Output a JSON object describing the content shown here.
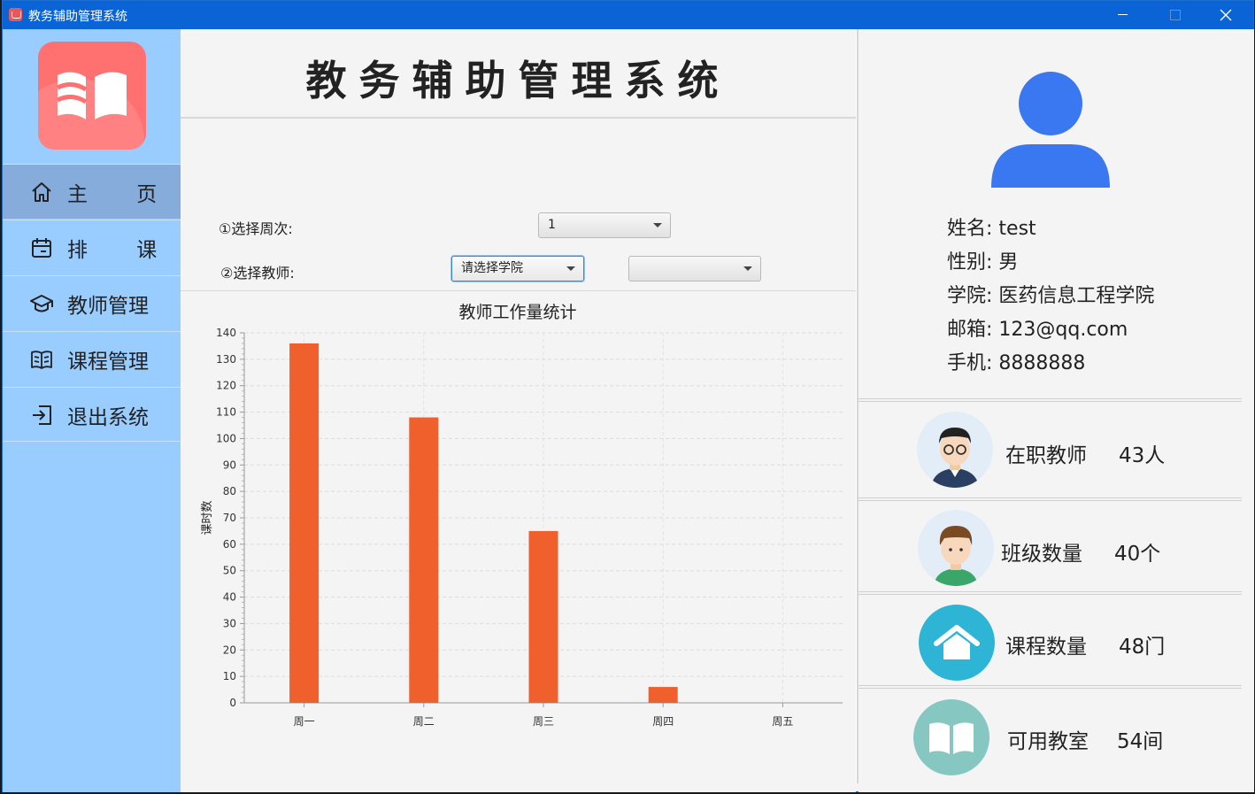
{
  "window": {
    "title": "教务辅助管理系统"
  },
  "sidebar": {
    "items": [
      {
        "label": "主 页",
        "icon": "home-icon",
        "active": true
      },
      {
        "label": "排 课",
        "icon": "calendar-icon",
        "active": false
      },
      {
        "label": "教师管理",
        "icon": "graduation-cap-icon",
        "active": false
      },
      {
        "label": "课程管理",
        "icon": "book-open-icon",
        "active": false
      },
      {
        "label": "退出系统",
        "icon": "logout-icon",
        "active": false
      }
    ]
  },
  "main": {
    "title": "教务辅助管理系统",
    "week_label": "①选择周次:",
    "week_value": "1",
    "teacher_label": "②选择教师:",
    "college_placeholder": "请选择学院",
    "teacher_value": ""
  },
  "chart_data": {
    "type": "bar",
    "title": "教师工作量统计",
    "ylabel": "课时数",
    "xlabel": "",
    "categories": [
      "周一",
      "周二",
      "周三",
      "周四",
      "周五"
    ],
    "values": [
      136,
      108,
      65,
      6,
      0
    ],
    "ylim": [
      0,
      140
    ],
    "yticks": [
      0,
      10,
      20,
      30,
      40,
      50,
      60,
      70,
      80,
      90,
      100,
      110,
      120,
      130,
      140
    ],
    "grid": true,
    "bar_color": "#f0602d"
  },
  "profile": {
    "name_label": "姓名:",
    "name": "test",
    "gender_label": "性别:",
    "gender": "男",
    "college_label": "学院:",
    "college": "医药信息工程学院",
    "email_label": "邮箱:",
    "email": "123@qq.com",
    "phone_label": "手机:",
    "phone": "8888888"
  },
  "stats": [
    {
      "label": "在职教师",
      "value": "43人",
      "icon": "teacher-avatar-icon"
    },
    {
      "label": "班级数量",
      "value": "40个",
      "icon": "student-avatar-icon"
    },
    {
      "label": "课程数量",
      "value": "48门",
      "icon": "house-icon"
    },
    {
      "label": "可用教室",
      "value": "54间",
      "icon": "open-book-icon"
    }
  ],
  "colors": {
    "titlebar": "#0a64d6",
    "sidebar": "#99ccff",
    "sidebar_active": "#86acdc",
    "logo": "#ff7070",
    "avatar": "#3a78f2"
  }
}
